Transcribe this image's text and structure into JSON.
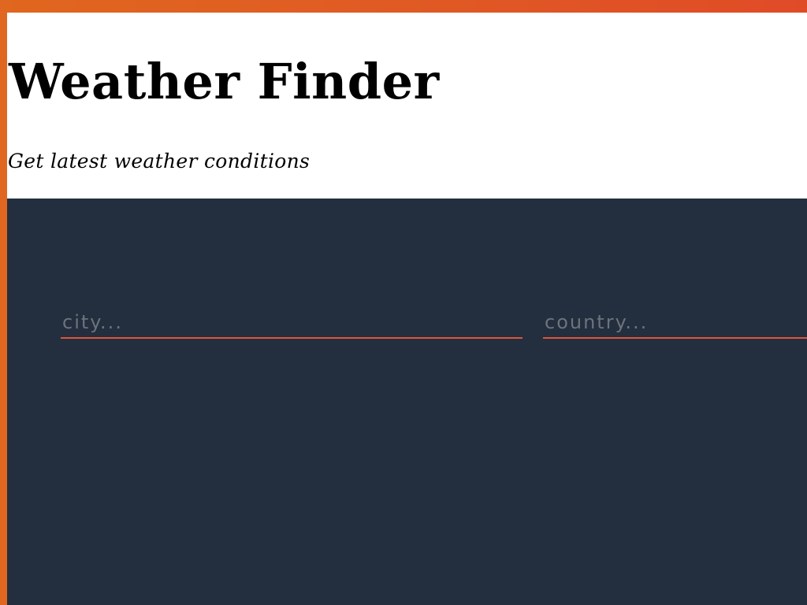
{
  "header": {
    "title": "Weather Finder",
    "subtitle": "Get latest weather conditions"
  },
  "form": {
    "city": {
      "placeholder": "city...",
      "value": ""
    },
    "country": {
      "placeholder": "country...",
      "value": ""
    }
  },
  "colors": {
    "accent_gradient_start": "#e0671f",
    "accent_gradient_end": "#e04b27",
    "header_background": "#ffffff",
    "main_background": "#232f3e",
    "input_underline": "#e0533c",
    "placeholder_text": "#6c737c"
  }
}
